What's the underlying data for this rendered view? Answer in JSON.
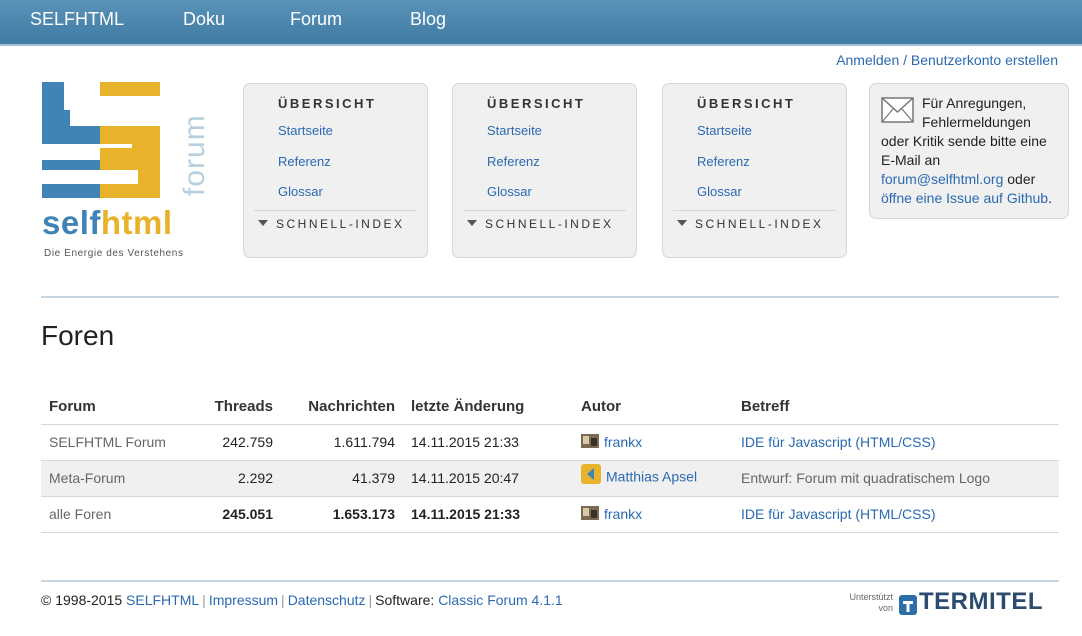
{
  "nav": {
    "items": [
      "SELFHTML",
      "Doku",
      "Forum",
      "Blog"
    ]
  },
  "login": {
    "label": "Anmelden / Benutzerkonto erstellen"
  },
  "logo": {
    "text_self": "self",
    "text_html": "html",
    "forum": "forum",
    "tagline": "Die Energie des Verstehens"
  },
  "boxes": [
    {
      "heading": "ÜBERSICHT",
      "links": [
        "Startseite",
        "Referenz",
        "Glossar"
      ],
      "index": "SCHNELL-INDEX"
    },
    {
      "heading": "ÜBERSICHT",
      "links": [
        "Startseite",
        "Referenz",
        "Glossar"
      ],
      "index": "SCHNELL-INDEX"
    },
    {
      "heading": "ÜBERSICHT",
      "links": [
        "Startseite",
        "Referenz",
        "Glossar"
      ],
      "index": "SCHNELL-INDEX"
    }
  ],
  "info": {
    "text1": "Für Anregungen, Fehlermeldungen oder Kritik sende bitte eine E-Mail an",
    "email": "forum@selfhtml.org",
    "text2": "oder",
    "issue": "öffne eine Issue auf Github",
    "text3": "."
  },
  "page": {
    "title": "Foren"
  },
  "table": {
    "headers": [
      "Forum",
      "Threads",
      "Nachrichten",
      "letzte Änderung",
      "Autor",
      "Betreff"
    ],
    "rows": [
      {
        "forum": "SELFHTML Forum",
        "threads": "242.759",
        "messages": "1.611.794",
        "changed": "14.11.2015 21:33",
        "author": "frankx",
        "subject": "IDE für Javascript (HTML/CSS)"
      },
      {
        "forum": "Meta-Forum",
        "threads": "2.292",
        "messages": "41.379",
        "changed": "14.11.2015 20:47",
        "author": "Matthias Apsel",
        "subject": "Entwurf: Forum mit quadratischem Logo"
      },
      {
        "forum": "alle Foren",
        "threads": "245.051",
        "messages": "1.653.173",
        "changed": "14.11.2015 21:33",
        "author": "frankx",
        "subject": "IDE für Javascript (HTML/CSS)"
      }
    ]
  },
  "footer": {
    "copyright": "© 1998-2015",
    "selfhtml": "SELFHTML",
    "impressum": "Impressum",
    "datenschutz": "Datenschutz",
    "software_label": "Software:",
    "software": "Classic Forum 4.1.1"
  },
  "sponsor": {
    "label_line1": "Unterstützt",
    "label_line2": "von",
    "name": "TERMITEL"
  },
  "colors": {
    "nav": "#4a86ae",
    "link": "#2a6ab0",
    "logo_blue": "#3f84b4",
    "logo_gold": "#e8b22a"
  }
}
